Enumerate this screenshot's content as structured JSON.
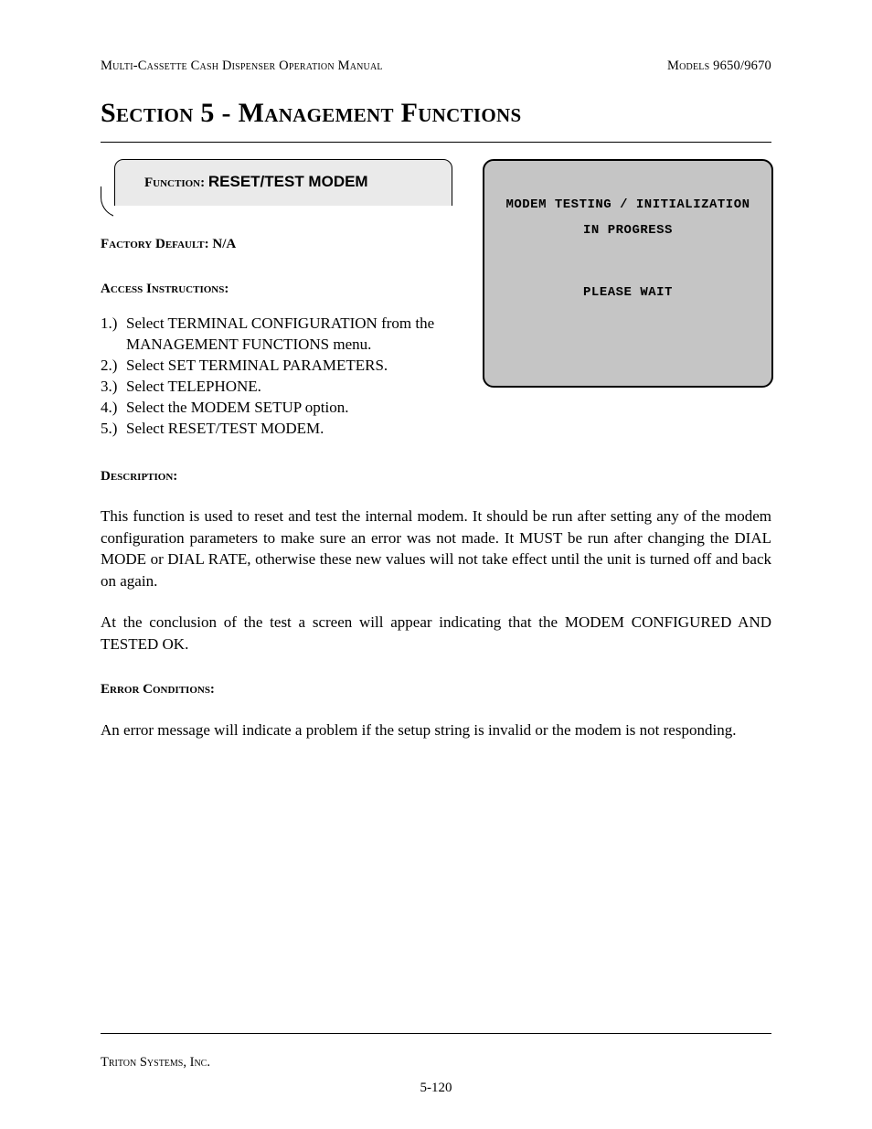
{
  "header": {
    "left": "Multi-Cassette Cash Dispenser Operation Manual",
    "right": "Models 9650/9670"
  },
  "section_title": "Section 5 - Management Functions",
  "function_box": {
    "label": "Function:  ",
    "value": "RESET/TEST MODEM"
  },
  "screen": {
    "line1": "MODEM TESTING / INITIALIZATION",
    "line2": "IN PROGRESS",
    "line3": "PLEASE WAIT"
  },
  "factory_default": {
    "label": "Factory Default: ",
    "value": "N/A"
  },
  "access_instructions_label": "Access Instructions:",
  "steps": [
    {
      "num": "1.)",
      "text": "Select TERMINAL CONFIGURATION from the MANAGEMENT FUNCTIONS menu."
    },
    {
      "num": "2.)",
      "text": "Select SET TERMINAL PARAMETERS."
    },
    {
      "num": "3.)",
      "text": "Select TELEPHONE."
    },
    {
      "num": "4.)",
      "text": "Select the MODEM SETUP option."
    },
    {
      "num": "5.)",
      "text": "Select RESET/TEST MODEM."
    }
  ],
  "description_label": "Description:",
  "description_p1": "This function is used to reset and test the internal modem.  It should be run after setting any of the modem configuration parameters to make sure an error was not made.  It MUST be run after changing the DIAL MODE or DIAL RATE, otherwise these new values will not take effect until the unit is turned off and back on again.",
  "description_p2": "At the conclusion of the test a screen will appear indicating that the MODEM CONFIGURED AND TESTED OK.",
  "error_conditions_label": "Error Conditions:",
  "error_conditions_p": "An error message will indicate a problem if the setup string is invalid or the modem is not responding.",
  "footer": {
    "company": "Triton Systems, Inc.",
    "page_number": "5-120"
  }
}
